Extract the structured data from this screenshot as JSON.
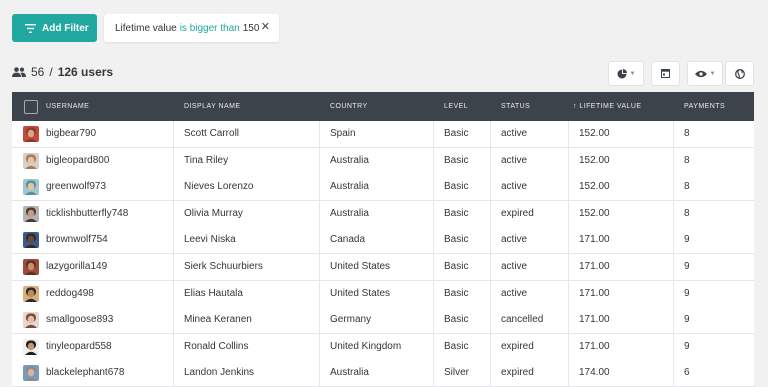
{
  "toolbar": {
    "add_filter_label": "Add Filter",
    "filter": {
      "field": "Lifetime value",
      "operator": "is bigger than",
      "value": "150"
    }
  },
  "summary": {
    "shown": "56",
    "separator": "/",
    "total": "126 users"
  },
  "columns": [
    "USERNAME",
    "DISPLAY NAME",
    "COUNTRY",
    "LEVEL",
    "STATUS",
    "↑ LIFETIME VALUE",
    "PAYMENTS"
  ],
  "rows": [
    {
      "username": "bigbear790",
      "display_name": "Scott Carroll",
      "country": "Spain",
      "level": "Basic",
      "status": "active",
      "lifetime_value": "152.00",
      "payments": "8",
      "avatar_colors": [
        "#8a3a2c",
        "#d9a588",
        "#c44a3a"
      ]
    },
    {
      "username": "bigleopard800",
      "display_name": "Tina Riley",
      "country": "Australia",
      "level": "Basic",
      "status": "active",
      "lifetime_value": "152.00",
      "payments": "8",
      "avatar_colors": [
        "#a37c5a",
        "#e8c4a8",
        "#d8d0c8"
      ]
    },
    {
      "username": "greenwolf973",
      "display_name": "Nieves Lorenzo",
      "country": "Australia",
      "level": "Basic",
      "status": "active",
      "lifetime_value": "152.00",
      "payments": "8",
      "avatar_colors": [
        "#5a8f9a",
        "#e6c2a4",
        "#9fc7cf"
      ]
    },
    {
      "username": "ticklishbutterfly748",
      "display_name": "Olivia Murray",
      "country": "Australia",
      "level": "Basic",
      "status": "expired",
      "lifetime_value": "152.00",
      "payments": "8",
      "avatar_colors": [
        "#4a3a34",
        "#c99a82",
        "#b3b3b3"
      ]
    },
    {
      "username": "brownwolf754",
      "display_name": "Leevi Niska",
      "country": "Canada",
      "level": "Basic",
      "status": "active",
      "lifetime_value": "171.00",
      "payments": "9",
      "avatar_colors": [
        "#2b2b2b",
        "#6b4a3a",
        "#3a5a8a"
      ]
    },
    {
      "username": "lazygorilla149",
      "display_name": "Sierk Schuurbiers",
      "country": "United States",
      "level": "Basic",
      "status": "active",
      "lifetime_value": "171.00",
      "payments": "9",
      "avatar_colors": [
        "#5a3328",
        "#c98d70",
        "#a04a3a"
      ]
    },
    {
      "username": "reddog498",
      "display_name": "Elias Hautala",
      "country": "United States",
      "level": "Basic",
      "status": "active",
      "lifetime_value": "171.00",
      "payments": "9",
      "avatar_colors": [
        "#2a2a2a",
        "#c08a5a",
        "#d9b07a"
      ]
    },
    {
      "username": "smallgoose893",
      "display_name": "Minea Keranen",
      "country": "Germany",
      "level": "Basic",
      "status": "cancelled",
      "lifetime_value": "171.00",
      "payments": "9",
      "avatar_colors": [
        "#7a4a3a",
        "#e7bca0",
        "#e6d8d0"
      ]
    },
    {
      "username": "tinyleopard558",
      "display_name": "Ronald Collins",
      "country": "United Kingdom",
      "level": "Basic",
      "status": "expired",
      "lifetime_value": "171.00",
      "payments": "9",
      "avatar_colors": [
        "#1e1e1e",
        "#c7956e",
        "#f0f0f0"
      ]
    },
    {
      "username": "blackelephant678",
      "display_name": "Landon Jenkins",
      "country": "Australia",
      "level": "Silver",
      "status": "expired",
      "lifetime_value": "174.00",
      "payments": "6",
      "avatar_colors": [
        "#8a8a8a",
        "#d8b49a",
        "#7a9ac0"
      ]
    }
  ],
  "colors": {
    "accent": "#21a8a0",
    "header_bg": "#3c434a",
    "page_bg": "#f1f1f1"
  },
  "icons": {
    "add_filter": "filter-lines-icon",
    "users": "users-icon",
    "tools": [
      "pie-chart-icon",
      "calendar-icon",
      "eye-icon",
      "globe-icon"
    ],
    "remove_filter": "close-icon"
  }
}
